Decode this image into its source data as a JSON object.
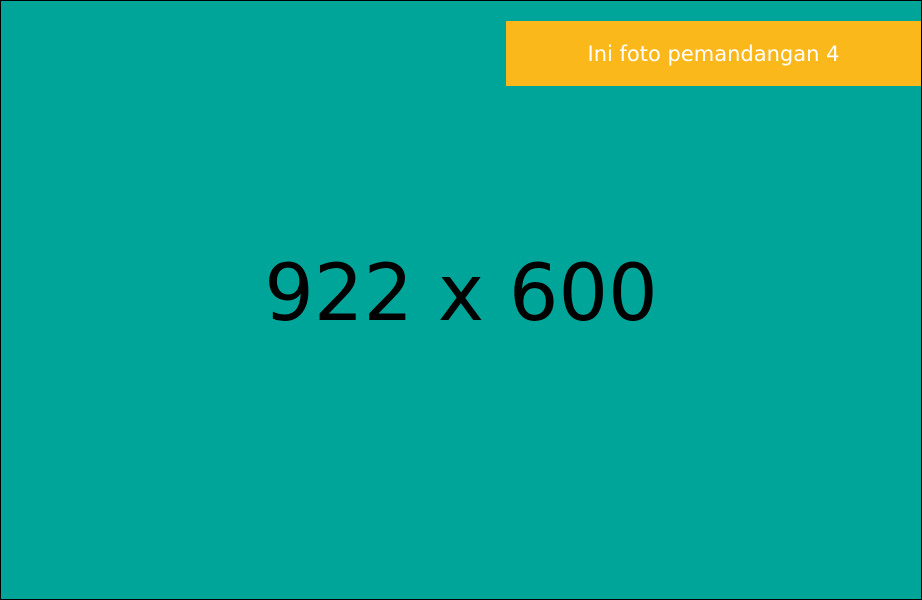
{
  "placeholder": {
    "caption": "Ini foto pemandangan 4",
    "dimensions_text": "922 x 600",
    "colors": {
      "background": "#00a59a",
      "caption_background": "#fbb81b",
      "caption_text": "#ffffff",
      "dimensions_text": "#000000"
    }
  }
}
